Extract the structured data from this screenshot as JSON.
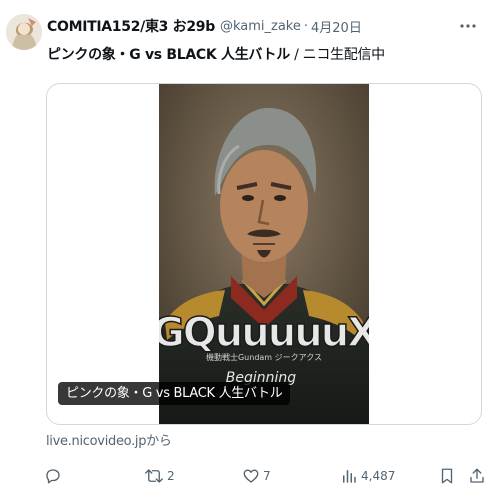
{
  "author": {
    "display_name": "COMITIA152/東3 お29b",
    "handle": "@kami_zake",
    "separator": "·",
    "date": "4月20日"
  },
  "menu": {
    "more_label": "•••"
  },
  "tweet": {
    "title_bold": "ピンクの象・G vs BLACK 人生バトル",
    "title_suffix": " / ニコ生配信中"
  },
  "card": {
    "caption": "ピンクの象・G vs BLACK 人生バトル",
    "logo_main": "GQuuuuuX",
    "logo_sub": "機動戦士Gundam ジークアクス",
    "logo_beginning": "Beginning",
    "domain": "live.nicovideo.jpから"
  },
  "actions": {
    "reply_count": "",
    "retweet_count": "2",
    "like_count": "7",
    "views_count": "4,487"
  },
  "icons": {
    "reply": "reply-icon",
    "retweet": "retweet-icon",
    "like": "heart-icon",
    "views": "views-icon",
    "bookmark": "bookmark-icon",
    "share": "share-icon",
    "more": "more-icon"
  },
  "colors": {
    "text": "#0f1419",
    "secondary": "#536471",
    "border": "#cfd9de",
    "caption_bg": "#000000"
  }
}
